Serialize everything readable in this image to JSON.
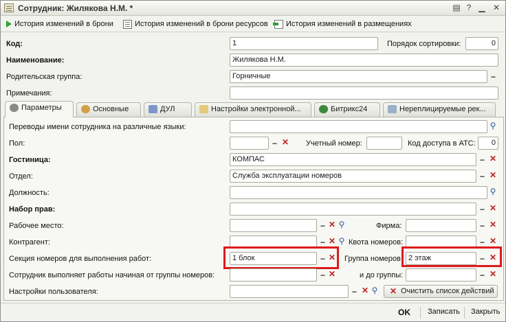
{
  "title": "Сотрудник: Жилякова Н.М. *",
  "colors": {
    "highlight": "#dd1a1a",
    "select_ok": "#2aa42a"
  },
  "toolbar": {
    "history_booking": "История изменений в брони",
    "history_resources": "История изменений в брони ресурсов",
    "history_placements": "История изменений в размещениях"
  },
  "header": {
    "code_label": "Код:",
    "code_value": "1",
    "sort_label": "Порядок сортировки:",
    "sort_value": "0",
    "name_label": "Наименование:",
    "name_value": "Жилякова Н.М.",
    "parent_label": "Родительская группа:",
    "parent_value": "Горничные",
    "notes_label": "Примечания:",
    "notes_value": ""
  },
  "tabs": [
    {
      "label": "Параметры",
      "icon": "gear-icon"
    },
    {
      "label": "Основные",
      "icon": "user-icon"
    },
    {
      "label": "ДУЛ",
      "icon": "document-icon"
    },
    {
      "label": "Настройки электронной...",
      "icon": "mail-icon"
    },
    {
      "label": "Битрикс24",
      "icon": "globe-icon"
    },
    {
      "label": "Нереплицируемые рек...",
      "icon": "table-icon"
    }
  ],
  "params": {
    "translations_label": "Переводы имени сотрудника на различные языки:",
    "translations_value": "",
    "gender_label": "Пол:",
    "gender_value": "",
    "account_label": "Учетный номер:",
    "account_value": "",
    "ats_label": "Код доступа в АТС:",
    "ats_value": "0",
    "hotel_label": "Гостиница:",
    "hotel_value": "КОМПАС",
    "dept_label": "Отдел:",
    "dept_value": "Служба эксплуатации номеров",
    "position_label": "Должность:",
    "position_value": "",
    "rights_label": "Набор прав:",
    "rights_value": "",
    "workplace_label": "Рабочее место:",
    "workplace_value": "",
    "firm_label": "Фирма:",
    "firm_value": "",
    "contractor_label": "Контрагент:",
    "contractor_value": "",
    "quota_label": "Квота номеров:",
    "quota_value": "",
    "section_label": "Секция номеров для выполнения работ:",
    "section_value": "1 блок",
    "group_label": "Группа номеров",
    "group_value": "2 этаж",
    "from_group_label": "Сотрудник выполняет работы начиная от группы номеров:",
    "from_group_value": "",
    "to_group_label": "и до группы:",
    "to_group_value": "",
    "user_settings_label": "Настройки пользователя:",
    "user_settings_value": "",
    "clear_actions": "Очистить список действий"
  },
  "footer": {
    "ok": "OK",
    "save": "Записать",
    "close": "Закрыть"
  }
}
